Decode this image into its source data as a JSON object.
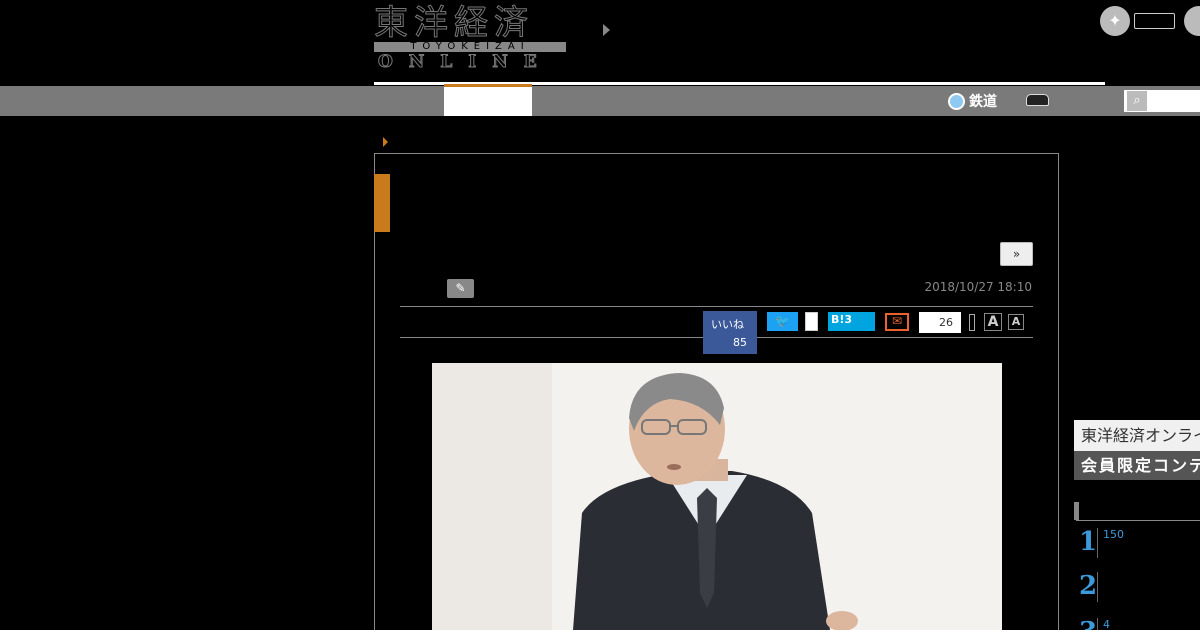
{
  "header": {
    "logo_jp": "東洋経済",
    "logo_romaji": "TOYOKEIZAI",
    "logo_online": "ONLINE"
  },
  "nav": {
    "rail_label": "鉄道"
  },
  "article": {
    "next_label": "»",
    "date": "2018/10/27 18:10",
    "facebook_label": "いいね",
    "facebook_count": "85",
    "hatena_label": "B!",
    "hatena_count": "3",
    "comment_count": "26",
    "font_big_label": "A",
    "font_small_label": "A"
  },
  "sidebar": {
    "member_top": "東洋経済オンライン",
    "member_bottom": "会員限定コンテンツ",
    "ranking": [
      {
        "rank": "1",
        "text": "150"
      },
      {
        "rank": "2",
        "text": ""
      },
      {
        "rank": "3",
        "text": "4"
      }
    ]
  },
  "colors": {
    "accent": "#c97a1c",
    "nav_bg": "#7a7a7a",
    "facebook": "#3b5998",
    "twitter": "#1da1f2",
    "hatena": "#00a4de",
    "mail": "#e8632d",
    "ranking": "#3b9ad9"
  },
  "icons": [
    "twitter-icon",
    "facebook-icon",
    "rail-icon",
    "car-icon",
    "search-icon",
    "author-icon",
    "mail-icon"
  ]
}
